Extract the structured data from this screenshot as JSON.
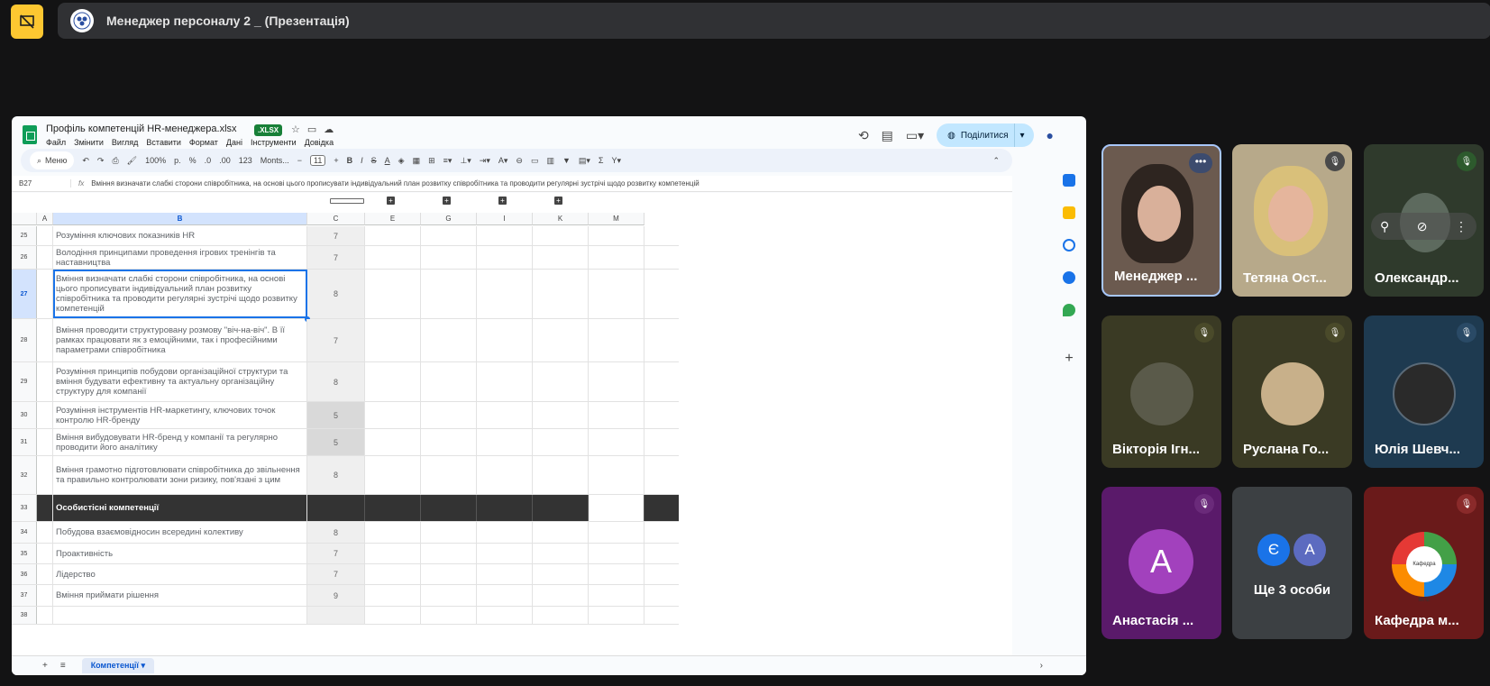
{
  "meeting": {
    "title": "Менеджер персоналу 2 _ (Презентація)"
  },
  "sheet": {
    "doc_title": "Профіль компетенцій HR-менеджера.xlsx",
    "badge": ".XLSX",
    "menu": [
      "Файл",
      "Змінити",
      "Вигляд",
      "Вставити",
      "Формат",
      "Дані",
      "Інструменти",
      "Довідка"
    ],
    "share_label": "Поділитися",
    "toolbar": {
      "search": "Меню",
      "zoom": "100%",
      "currency": "р.",
      "percent": "%",
      "dec_less": ".0",
      "dec_more": ".00",
      "num_format": "123",
      "font": "Monts...",
      "font_size": "11"
    },
    "cell_ref": "B27",
    "formula": "Вміння визначати слабкі сторони співробітника, на основі цього прописувати індивідуальний план розвитку співробітника та проводити регулярні зустрічі щодо розвитку компетенцій",
    "columns": [
      "A",
      "B",
      "C",
      "E",
      "G",
      "I",
      "K",
      "M"
    ],
    "rows": [
      {
        "n": "25",
        "b": "Розуміння ключових показників HR",
        "c": "7"
      },
      {
        "n": "26",
        "b": "Володіння принципами проведення ігрових тренінгів та наставництва",
        "c": "7"
      },
      {
        "n": "27",
        "b": "Вміння визначати слабкі сторони співробітника, на основі цього прописувати індивідуальний план розвитку співробітника та проводити регулярні зустрічі щодо розвитку компетенцій",
        "c": "8"
      },
      {
        "n": "28",
        "b": "Вміння проводити структуровану розмову \"віч-на-віч\". В її рамках працювати як з емоційними, так і професійними параметрами співробітника",
        "c": "7"
      },
      {
        "n": "29",
        "b": "Розуміння принципів побудови організаційної структури та вміння будувати ефективну та актуальну організаційну структуру для компанії",
        "c": "8"
      },
      {
        "n": "30",
        "b": "Розуміння інструментів HR-маркетингу, ключових точок контролю HR-бренду",
        "c": "5"
      },
      {
        "n": "31",
        "b": "Вміння вибудовувати HR-бренд у компанії та регулярно проводити його аналітику",
        "c": "5"
      },
      {
        "n": "32",
        "b": "Вміння грамотно підготовлювати співробітника до звільнення та правильно контролювати зони ризику, пов'язані з цим",
        "c": "8"
      },
      {
        "n": "33",
        "b": "Особистісні компетенції",
        "c": ""
      },
      {
        "n": "34",
        "b": "Побудова взаємовідносин всередині колективу",
        "c": "8"
      },
      {
        "n": "35",
        "b": "Проактивність",
        "c": "7"
      },
      {
        "n": "36",
        "b": "Лідерство",
        "c": "7"
      },
      {
        "n": "37",
        "b": "Вміння приймати рішення",
        "c": "9"
      },
      {
        "n": "38",
        "b": "",
        "c": ""
      }
    ],
    "sheet_tab": "Компетенції"
  },
  "participants": [
    {
      "name": "Менеджер ...",
      "type": "video"
    },
    {
      "name": "Тетяна Ост...",
      "type": "video"
    },
    {
      "name": "Олександр...",
      "type": "video"
    },
    {
      "name": "Вікторія Ігн...",
      "type": "photo"
    },
    {
      "name": "Руслана Го...",
      "type": "photo"
    },
    {
      "name": "Юлія Шевч...",
      "type": "photo"
    },
    {
      "name": "Анастасія ...",
      "type": "letter",
      "letter": "А"
    },
    {
      "name": "Ще 3 особи",
      "type": "group",
      "letters": [
        "Є",
        "А"
      ]
    },
    {
      "name": "Кафедра м...",
      "type": "logo",
      "logo_text": "Кафедра МПЕ"
    }
  ],
  "colors": {
    "accent": "#fdc731",
    "sheets_green": "#0f9d58",
    "selection": "#1a73e8"
  }
}
